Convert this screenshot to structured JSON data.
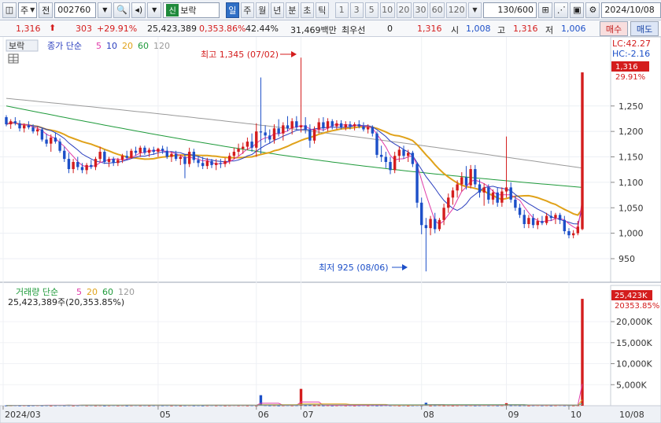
{
  "toolbar": {
    "market_label": "주",
    "market_sel": "전",
    "code": "002760",
    "name_badge": "신",
    "name": "보락",
    "period_tabs": [
      "일",
      "주",
      "월",
      "년",
      "분",
      "초",
      "틱"
    ],
    "period_active": "일",
    "intervals": [
      "1",
      "3",
      "5",
      "10",
      "20",
      "30",
      "60",
      "120"
    ],
    "count": "130",
    "count_total": "/600",
    "date": "2024/10/08"
  },
  "quote": {
    "price": "1,316",
    "change": "303",
    "change_pct": "+29.91%",
    "volume": "25,423,389",
    "volume_pct": "0,353.86%",
    "turnover_pct": "42.44%",
    "amount": "31,469백만",
    "preferred_label": "최우선",
    "preferred_value": "0",
    "preferred_price": "1,316",
    "open_label": "시",
    "open": "1,008",
    "high_label": "고",
    "high": "1,316",
    "low_label": "저",
    "low": "1,006",
    "buy_label": "매수",
    "sell_label": "매도"
  },
  "price_panel": {
    "name_tag": "보락",
    "legend_prefix": "종가 단순",
    "legend_periods": [
      {
        "label": "5",
        "color": "#e03aa8"
      },
      {
        "label": "10",
        "color": "#2b3fbf"
      },
      {
        "label": "20",
        "color": "#e0a21a"
      },
      {
        "label": "60",
        "color": "#1e9a3a"
      },
      {
        "label": "120",
        "color": "#9a9a9a"
      }
    ],
    "lc_label": "LC:42.27",
    "hc_label": "HC:-2.16",
    "high_annotation": "최고 1,345 (07/02)",
    "low_annotation": "최저 925 (08/06)",
    "current_price_tag": "1,316",
    "current_pct_tag": "29.91%",
    "y_ticks": [
      "1,250",
      "1,200",
      "1,150",
      "1,100",
      "1,050",
      "1,000",
      "950"
    ]
  },
  "volume_panel": {
    "legend_prefix": "거래량 단순",
    "legend_periods": [
      {
        "label": "5",
        "color": "#e03aa8"
      },
      {
        "label": "20",
        "color": "#e0a21a"
      },
      {
        "label": "60",
        "color": "#1e9a3a"
      },
      {
        "label": "120",
        "color": "#9a9a9a"
      }
    ],
    "info": "25,423,389주(20,353.85%)",
    "current_tag": "25,423K",
    "current_pct_tag": "20353.85%",
    "y_ticks": [
      "20,000K",
      "15,000K",
      "10,000K",
      "5,000K"
    ]
  },
  "x_axis": {
    "labels": [
      "2024/03",
      "05",
      "06",
      "07",
      "08",
      "09",
      "10",
      "10/08"
    ]
  },
  "colors": {
    "up": "#d41d1d",
    "down": "#1c4fc8",
    "accent": "#2f6fc6"
  },
  "chart_data": {
    "type": "candlestick",
    "price_range": [
      920,
      1330
    ],
    "series_note": "daily candles (open, high, low, close) read approximately from chart",
    "candles": [
      {
        "i": 0,
        "o": 1228,
        "h": 1232,
        "l": 1210,
        "c": 1214
      },
      {
        "i": 1,
        "o": 1214,
        "h": 1224,
        "l": 1205,
        "c": 1220
      },
      {
        "i": 2,
        "o": 1220,
        "h": 1228,
        "l": 1212,
        "c": 1216
      },
      {
        "i": 3,
        "o": 1216,
        "h": 1222,
        "l": 1200,
        "c": 1206
      },
      {
        "i": 4,
        "o": 1206,
        "h": 1216,
        "l": 1198,
        "c": 1212
      },
      {
        "i": 5,
        "o": 1212,
        "h": 1220,
        "l": 1204,
        "c": 1208
      },
      {
        "i": 6,
        "o": 1208,
        "h": 1214,
        "l": 1196,
        "c": 1200
      },
      {
        "i": 7,
        "o": 1200,
        "h": 1210,
        "l": 1192,
        "c": 1204
      },
      {
        "i": 8,
        "o": 1204,
        "h": 1208,
        "l": 1180,
        "c": 1184
      },
      {
        "i": 9,
        "o": 1184,
        "h": 1196,
        "l": 1170,
        "c": 1176
      },
      {
        "i": 10,
        "o": 1176,
        "h": 1194,
        "l": 1160,
        "c": 1188
      },
      {
        "i": 11,
        "o": 1188,
        "h": 1198,
        "l": 1176,
        "c": 1180
      },
      {
        "i": 12,
        "o": 1180,
        "h": 1186,
        "l": 1158,
        "c": 1162
      },
      {
        "i": 13,
        "o": 1162,
        "h": 1170,
        "l": 1140,
        "c": 1146
      },
      {
        "i": 14,
        "o": 1146,
        "h": 1158,
        "l": 1118,
        "c": 1126
      },
      {
        "i": 15,
        "o": 1126,
        "h": 1146,
        "l": 1118,
        "c": 1140
      },
      {
        "i": 16,
        "o": 1140,
        "h": 1150,
        "l": 1124,
        "c": 1130
      },
      {
        "i": 17,
        "o": 1130,
        "h": 1138,
        "l": 1118,
        "c": 1124
      },
      {
        "i": 18,
        "o": 1124,
        "h": 1138,
        "l": 1116,
        "c": 1134
      },
      {
        "i": 19,
        "o": 1134,
        "h": 1144,
        "l": 1126,
        "c": 1130
      },
      {
        "i": 20,
        "o": 1130,
        "h": 1150,
        "l": 1124,
        "c": 1146
      },
      {
        "i": 21,
        "o": 1146,
        "h": 1170,
        "l": 1140,
        "c": 1160
      },
      {
        "i": 22,
        "o": 1160,
        "h": 1164,
        "l": 1136,
        "c": 1140
      },
      {
        "i": 23,
        "o": 1140,
        "h": 1150,
        "l": 1130,
        "c": 1146
      },
      {
        "i": 24,
        "o": 1146,
        "h": 1150,
        "l": 1132,
        "c": 1138
      },
      {
        "i": 25,
        "o": 1138,
        "h": 1148,
        "l": 1132,
        "c": 1144
      },
      {
        "i": 26,
        "o": 1144,
        "h": 1156,
        "l": 1138,
        "c": 1152
      },
      {
        "i": 27,
        "o": 1152,
        "h": 1162,
        "l": 1144,
        "c": 1148
      },
      {
        "i": 28,
        "o": 1148,
        "h": 1166,
        "l": 1146,
        "c": 1162
      },
      {
        "i": 29,
        "o": 1162,
        "h": 1170,
        "l": 1152,
        "c": 1158
      },
      {
        "i": 30,
        "o": 1158,
        "h": 1172,
        "l": 1150,
        "c": 1168
      },
      {
        "i": 31,
        "o": 1168,
        "h": 1172,
        "l": 1154,
        "c": 1158
      },
      {
        "i": 32,
        "o": 1158,
        "h": 1168,
        "l": 1150,
        "c": 1164
      },
      {
        "i": 33,
        "o": 1164,
        "h": 1170,
        "l": 1154,
        "c": 1160
      },
      {
        "i": 34,
        "o": 1160,
        "h": 1168,
        "l": 1150,
        "c": 1166
      },
      {
        "i": 35,
        "o": 1166,
        "h": 1172,
        "l": 1156,
        "c": 1162
      },
      {
        "i": 36,
        "o": 1162,
        "h": 1170,
        "l": 1146,
        "c": 1150
      },
      {
        "i": 37,
        "o": 1150,
        "h": 1160,
        "l": 1140,
        "c": 1156
      },
      {
        "i": 38,
        "o": 1156,
        "h": 1162,
        "l": 1142,
        "c": 1146
      },
      {
        "i": 39,
        "o": 1146,
        "h": 1154,
        "l": 1134,
        "c": 1150
      },
      {
        "i": 40,
        "o": 1150,
        "h": 1156,
        "l": 1108,
        "c": 1136
      },
      {
        "i": 41,
        "o": 1136,
        "h": 1168,
        "l": 1130,
        "c": 1160
      },
      {
        "i": 42,
        "o": 1160,
        "h": 1166,
        "l": 1138,
        "c": 1144
      },
      {
        "i": 43,
        "o": 1144,
        "h": 1152,
        "l": 1130,
        "c": 1138
      },
      {
        "i": 44,
        "o": 1138,
        "h": 1150,
        "l": 1126,
        "c": 1132
      },
      {
        "i": 45,
        "o": 1132,
        "h": 1148,
        "l": 1126,
        "c": 1142
      },
      {
        "i": 46,
        "o": 1142,
        "h": 1146,
        "l": 1128,
        "c": 1134
      },
      {
        "i": 47,
        "o": 1134,
        "h": 1146,
        "l": 1124,
        "c": 1138
      },
      {
        "i": 48,
        "o": 1138,
        "h": 1146,
        "l": 1128,
        "c": 1136
      },
      {
        "i": 49,
        "o": 1136,
        "h": 1148,
        "l": 1130,
        "c": 1142
      },
      {
        "i": 50,
        "o": 1142,
        "h": 1158,
        "l": 1136,
        "c": 1152
      },
      {
        "i": 51,
        "o": 1152,
        "h": 1168,
        "l": 1146,
        "c": 1160
      },
      {
        "i": 52,
        "o": 1160,
        "h": 1176,
        "l": 1152,
        "c": 1166
      },
      {
        "i": 53,
        "o": 1166,
        "h": 1178,
        "l": 1156,
        "c": 1170
      },
      {
        "i": 54,
        "o": 1170,
        "h": 1188,
        "l": 1164,
        "c": 1180
      },
      {
        "i": 55,
        "o": 1180,
        "h": 1196,
        "l": 1160,
        "c": 1168
      },
      {
        "i": 56,
        "o": 1168,
        "h": 1216,
        "l": 1150,
        "c": 1200
      },
      {
        "i": 57,
        "o": 1200,
        "h": 1306,
        "l": 1156,
        "c": 1198
      },
      {
        "i": 58,
        "o": 1198,
        "h": 1212,
        "l": 1178,
        "c": 1192
      },
      {
        "i": 59,
        "o": 1192,
        "h": 1204,
        "l": 1176,
        "c": 1184
      },
      {
        "i": 60,
        "o": 1184,
        "h": 1214,
        "l": 1176,
        "c": 1206
      },
      {
        "i": 61,
        "o": 1206,
        "h": 1224,
        "l": 1190,
        "c": 1196
      },
      {
        "i": 62,
        "o": 1196,
        "h": 1218,
        "l": 1182,
        "c": 1212
      },
      {
        "i": 63,
        "o": 1212,
        "h": 1230,
        "l": 1200,
        "c": 1206
      },
      {
        "i": 64,
        "o": 1206,
        "h": 1226,
        "l": 1194,
        "c": 1220
      },
      {
        "i": 65,
        "o": 1220,
        "h": 1230,
        "l": 1202,
        "c": 1208
      },
      {
        "i": 66,
        "o": 1208,
        "h": 1345,
        "l": 1198,
        "c": 1212
      },
      {
        "i": 67,
        "o": 1212,
        "h": 1228,
        "l": 1196,
        "c": 1204
      },
      {
        "i": 68,
        "o": 1204,
        "h": 1214,
        "l": 1168,
        "c": 1182
      },
      {
        "i": 69,
        "o": 1182,
        "h": 1210,
        "l": 1176,
        "c": 1204
      },
      {
        "i": 70,
        "o": 1204,
        "h": 1226,
        "l": 1196,
        "c": 1218
      },
      {
        "i": 71,
        "o": 1218,
        "h": 1228,
        "l": 1200,
        "c": 1206
      },
      {
        "i": 72,
        "o": 1206,
        "h": 1226,
        "l": 1200,
        "c": 1220
      },
      {
        "i": 73,
        "o": 1220,
        "h": 1224,
        "l": 1204,
        "c": 1210
      },
      {
        "i": 74,
        "o": 1210,
        "h": 1222,
        "l": 1204,
        "c": 1216
      },
      {
        "i": 75,
        "o": 1216,
        "h": 1222,
        "l": 1204,
        "c": 1208
      },
      {
        "i": 76,
        "o": 1208,
        "h": 1220,
        "l": 1202,
        "c": 1214
      },
      {
        "i": 77,
        "o": 1214,
        "h": 1220,
        "l": 1204,
        "c": 1210
      },
      {
        "i": 78,
        "o": 1210,
        "h": 1218,
        "l": 1202,
        "c": 1214
      },
      {
        "i": 79,
        "o": 1214,
        "h": 1222,
        "l": 1206,
        "c": 1210
      },
      {
        "i": 80,
        "o": 1210,
        "h": 1218,
        "l": 1200,
        "c": 1204
      },
      {
        "i": 81,
        "o": 1204,
        "h": 1214,
        "l": 1196,
        "c": 1208
      },
      {
        "i": 82,
        "o": 1208,
        "h": 1212,
        "l": 1190,
        "c": 1196
      },
      {
        "i": 83,
        "o": 1196,
        "h": 1200,
        "l": 1148,
        "c": 1154
      },
      {
        "i": 84,
        "o": 1154,
        "h": 1172,
        "l": 1140,
        "c": 1150
      },
      {
        "i": 85,
        "o": 1150,
        "h": 1160,
        "l": 1128,
        "c": 1140
      },
      {
        "i": 86,
        "o": 1140,
        "h": 1150,
        "l": 1116,
        "c": 1124
      },
      {
        "i": 87,
        "o": 1124,
        "h": 1160,
        "l": 1118,
        "c": 1152
      },
      {
        "i": 88,
        "o": 1152,
        "h": 1170,
        "l": 1140,
        "c": 1164
      },
      {
        "i": 89,
        "o": 1164,
        "h": 1172,
        "l": 1146,
        "c": 1152
      },
      {
        "i": 90,
        "o": 1152,
        "h": 1164,
        "l": 1140,
        "c": 1158
      },
      {
        "i": 91,
        "o": 1158,
        "h": 1162,
        "l": 1130,
        "c": 1136
      },
      {
        "i": 92,
        "o": 1136,
        "h": 1140,
        "l": 1050,
        "c": 1060
      },
      {
        "i": 93,
        "o": 1060,
        "h": 1070,
        "l": 998,
        "c": 1016
      },
      {
        "i": 94,
        "o": 1016,
        "h": 1030,
        "l": 925,
        "c": 1010
      },
      {
        "i": 95,
        "o": 1010,
        "h": 1034,
        "l": 996,
        "c": 1028
      },
      {
        "i": 96,
        "o": 1028,
        "h": 1040,
        "l": 1000,
        "c": 1008
      },
      {
        "i": 97,
        "o": 1008,
        "h": 1030,
        "l": 1004,
        "c": 1026
      },
      {
        "i": 98,
        "o": 1026,
        "h": 1058,
        "l": 1016,
        "c": 1050
      },
      {
        "i": 99,
        "o": 1050,
        "h": 1078,
        "l": 1040,
        "c": 1070
      },
      {
        "i": 100,
        "o": 1070,
        "h": 1090,
        "l": 1056,
        "c": 1084
      },
      {
        "i": 101,
        "o": 1084,
        "h": 1104,
        "l": 1070,
        "c": 1096
      },
      {
        "i": 102,
        "o": 1096,
        "h": 1120,
        "l": 1082,
        "c": 1110
      },
      {
        "i": 103,
        "o": 1110,
        "h": 1132,
        "l": 1086,
        "c": 1094
      },
      {
        "i": 104,
        "o": 1094,
        "h": 1134,
        "l": 1088,
        "c": 1126
      },
      {
        "i": 105,
        "o": 1126,
        "h": 1134,
        "l": 1090,
        "c": 1096
      },
      {
        "i": 106,
        "o": 1096,
        "h": 1106,
        "l": 1070,
        "c": 1080
      },
      {
        "i": 107,
        "o": 1080,
        "h": 1098,
        "l": 1054,
        "c": 1090
      },
      {
        "i": 108,
        "o": 1090,
        "h": 1096,
        "l": 1058,
        "c": 1066
      },
      {
        "i": 109,
        "o": 1066,
        "h": 1086,
        "l": 1056,
        "c": 1080
      },
      {
        "i": 110,
        "o": 1080,
        "h": 1090,
        "l": 1052,
        "c": 1060
      },
      {
        "i": 111,
        "o": 1060,
        "h": 1090,
        "l": 1052,
        "c": 1082
      },
      {
        "i": 112,
        "o": 1082,
        "h": 1190,
        "l": 1070,
        "c": 1090
      },
      {
        "i": 113,
        "o": 1090,
        "h": 1100,
        "l": 1060,
        "c": 1066
      },
      {
        "i": 114,
        "o": 1066,
        "h": 1074,
        "l": 1044,
        "c": 1050
      },
      {
        "i": 115,
        "o": 1050,
        "h": 1058,
        "l": 1030,
        "c": 1036
      },
      {
        "i": 116,
        "o": 1036,
        "h": 1046,
        "l": 1010,
        "c": 1018
      },
      {
        "i": 117,
        "o": 1018,
        "h": 1036,
        "l": 1010,
        "c": 1030
      },
      {
        "i": 118,
        "o": 1030,
        "h": 1038,
        "l": 1010,
        "c": 1016
      },
      {
        "i": 119,
        "o": 1016,
        "h": 1030,
        "l": 1008,
        "c": 1024
      },
      {
        "i": 120,
        "o": 1024,
        "h": 1034,
        "l": 1016,
        "c": 1020
      },
      {
        "i": 121,
        "o": 1020,
        "h": 1040,
        "l": 1016,
        "c": 1034
      },
      {
        "i": 122,
        "o": 1034,
        "h": 1044,
        "l": 1024,
        "c": 1030
      },
      {
        "i": 123,
        "o": 1030,
        "h": 1040,
        "l": 1018,
        "c": 1036
      },
      {
        "i": 124,
        "o": 1036,
        "h": 1040,
        "l": 1018,
        "c": 1026
      },
      {
        "i": 125,
        "o": 1026,
        "h": 1034,
        "l": 998,
        "c": 1004
      },
      {
        "i": 126,
        "o": 1004,
        "h": 1010,
        "l": 990,
        "c": 996
      },
      {
        "i": 127,
        "o": 996,
        "h": 1006,
        "l": 990,
        "c": 1000
      },
      {
        "i": 128,
        "o": 1000,
        "h": 1024,
        "l": 996,
        "c": 1013
      },
      {
        "i": 129,
        "o": 1008,
        "h": 1316,
        "l": 1006,
        "c": 1316
      }
    ],
    "moving_averages": {
      "ma120": {
        "start": 1265,
        "end": 1128
      },
      "ma60": {
        "start": 1250,
        "end": 1090
      }
    },
    "volume_ylim": [
      0,
      26000
    ],
    "volume_last_k": 25423,
    "volume_spikes": [
      {
        "i": 57,
        "k": 2500
      },
      {
        "i": 66,
        "k": 4000
      },
      {
        "i": 94,
        "k": 700
      },
      {
        "i": 112,
        "k": 600
      },
      {
        "i": 129,
        "k": 25423
      }
    ]
  }
}
